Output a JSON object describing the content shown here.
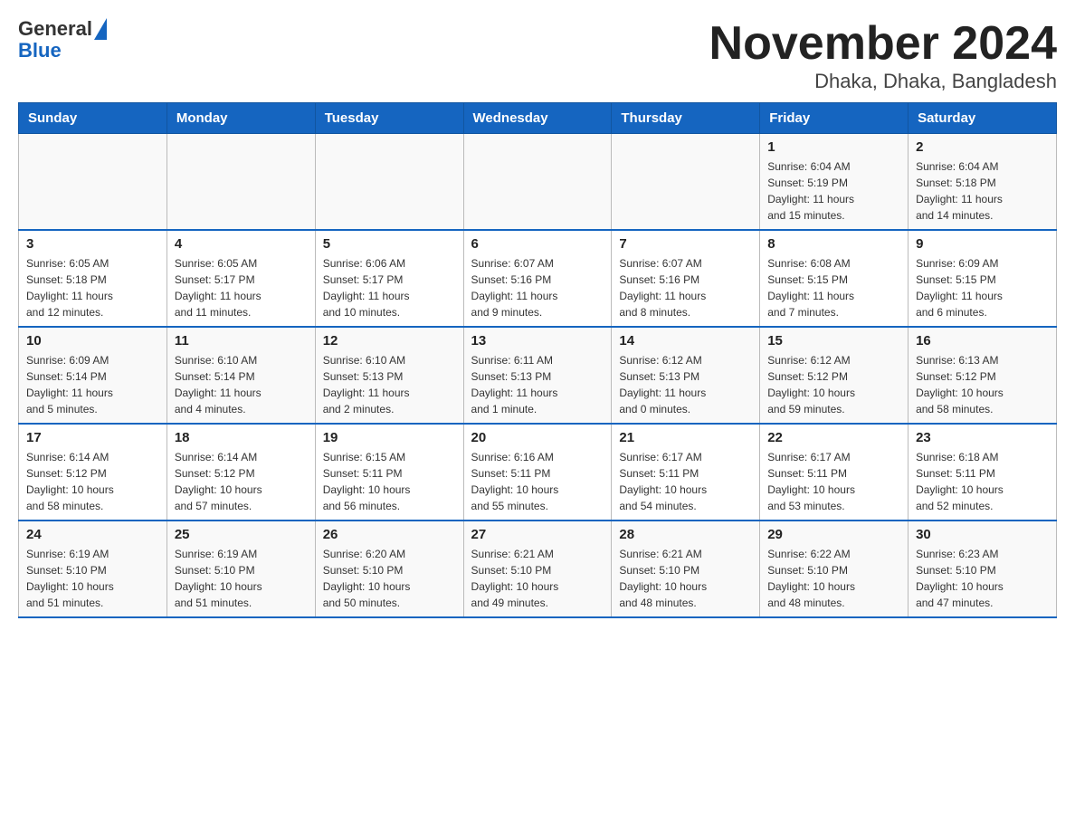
{
  "header": {
    "logo_general": "General",
    "logo_blue": "Blue",
    "title": "November 2024",
    "subtitle": "Dhaka, Dhaka, Bangladesh"
  },
  "days_of_week": [
    "Sunday",
    "Monday",
    "Tuesday",
    "Wednesday",
    "Thursday",
    "Friday",
    "Saturday"
  ],
  "weeks": [
    {
      "days": [
        {
          "number": "",
          "info": ""
        },
        {
          "number": "",
          "info": ""
        },
        {
          "number": "",
          "info": ""
        },
        {
          "number": "",
          "info": ""
        },
        {
          "number": "",
          "info": ""
        },
        {
          "number": "1",
          "info": "Sunrise: 6:04 AM\nSunset: 5:19 PM\nDaylight: 11 hours\nand 15 minutes."
        },
        {
          "number": "2",
          "info": "Sunrise: 6:04 AM\nSunset: 5:18 PM\nDaylight: 11 hours\nand 14 minutes."
        }
      ]
    },
    {
      "days": [
        {
          "number": "3",
          "info": "Sunrise: 6:05 AM\nSunset: 5:18 PM\nDaylight: 11 hours\nand 12 minutes."
        },
        {
          "number": "4",
          "info": "Sunrise: 6:05 AM\nSunset: 5:17 PM\nDaylight: 11 hours\nand 11 minutes."
        },
        {
          "number": "5",
          "info": "Sunrise: 6:06 AM\nSunset: 5:17 PM\nDaylight: 11 hours\nand 10 minutes."
        },
        {
          "number": "6",
          "info": "Sunrise: 6:07 AM\nSunset: 5:16 PM\nDaylight: 11 hours\nand 9 minutes."
        },
        {
          "number": "7",
          "info": "Sunrise: 6:07 AM\nSunset: 5:16 PM\nDaylight: 11 hours\nand 8 minutes."
        },
        {
          "number": "8",
          "info": "Sunrise: 6:08 AM\nSunset: 5:15 PM\nDaylight: 11 hours\nand 7 minutes."
        },
        {
          "number": "9",
          "info": "Sunrise: 6:09 AM\nSunset: 5:15 PM\nDaylight: 11 hours\nand 6 minutes."
        }
      ]
    },
    {
      "days": [
        {
          "number": "10",
          "info": "Sunrise: 6:09 AM\nSunset: 5:14 PM\nDaylight: 11 hours\nand 5 minutes."
        },
        {
          "number": "11",
          "info": "Sunrise: 6:10 AM\nSunset: 5:14 PM\nDaylight: 11 hours\nand 4 minutes."
        },
        {
          "number": "12",
          "info": "Sunrise: 6:10 AM\nSunset: 5:13 PM\nDaylight: 11 hours\nand 2 minutes."
        },
        {
          "number": "13",
          "info": "Sunrise: 6:11 AM\nSunset: 5:13 PM\nDaylight: 11 hours\nand 1 minute."
        },
        {
          "number": "14",
          "info": "Sunrise: 6:12 AM\nSunset: 5:13 PM\nDaylight: 11 hours\nand 0 minutes."
        },
        {
          "number": "15",
          "info": "Sunrise: 6:12 AM\nSunset: 5:12 PM\nDaylight: 10 hours\nand 59 minutes."
        },
        {
          "number": "16",
          "info": "Sunrise: 6:13 AM\nSunset: 5:12 PM\nDaylight: 10 hours\nand 58 minutes."
        }
      ]
    },
    {
      "days": [
        {
          "number": "17",
          "info": "Sunrise: 6:14 AM\nSunset: 5:12 PM\nDaylight: 10 hours\nand 58 minutes."
        },
        {
          "number": "18",
          "info": "Sunrise: 6:14 AM\nSunset: 5:12 PM\nDaylight: 10 hours\nand 57 minutes."
        },
        {
          "number": "19",
          "info": "Sunrise: 6:15 AM\nSunset: 5:11 PM\nDaylight: 10 hours\nand 56 minutes."
        },
        {
          "number": "20",
          "info": "Sunrise: 6:16 AM\nSunset: 5:11 PM\nDaylight: 10 hours\nand 55 minutes."
        },
        {
          "number": "21",
          "info": "Sunrise: 6:17 AM\nSunset: 5:11 PM\nDaylight: 10 hours\nand 54 minutes."
        },
        {
          "number": "22",
          "info": "Sunrise: 6:17 AM\nSunset: 5:11 PM\nDaylight: 10 hours\nand 53 minutes."
        },
        {
          "number": "23",
          "info": "Sunrise: 6:18 AM\nSunset: 5:11 PM\nDaylight: 10 hours\nand 52 minutes."
        }
      ]
    },
    {
      "days": [
        {
          "number": "24",
          "info": "Sunrise: 6:19 AM\nSunset: 5:10 PM\nDaylight: 10 hours\nand 51 minutes."
        },
        {
          "number": "25",
          "info": "Sunrise: 6:19 AM\nSunset: 5:10 PM\nDaylight: 10 hours\nand 51 minutes."
        },
        {
          "number": "26",
          "info": "Sunrise: 6:20 AM\nSunset: 5:10 PM\nDaylight: 10 hours\nand 50 minutes."
        },
        {
          "number": "27",
          "info": "Sunrise: 6:21 AM\nSunset: 5:10 PM\nDaylight: 10 hours\nand 49 minutes."
        },
        {
          "number": "28",
          "info": "Sunrise: 6:21 AM\nSunset: 5:10 PM\nDaylight: 10 hours\nand 48 minutes."
        },
        {
          "number": "29",
          "info": "Sunrise: 6:22 AM\nSunset: 5:10 PM\nDaylight: 10 hours\nand 48 minutes."
        },
        {
          "number": "30",
          "info": "Sunrise: 6:23 AM\nSunset: 5:10 PM\nDaylight: 10 hours\nand 47 minutes."
        }
      ]
    }
  ]
}
